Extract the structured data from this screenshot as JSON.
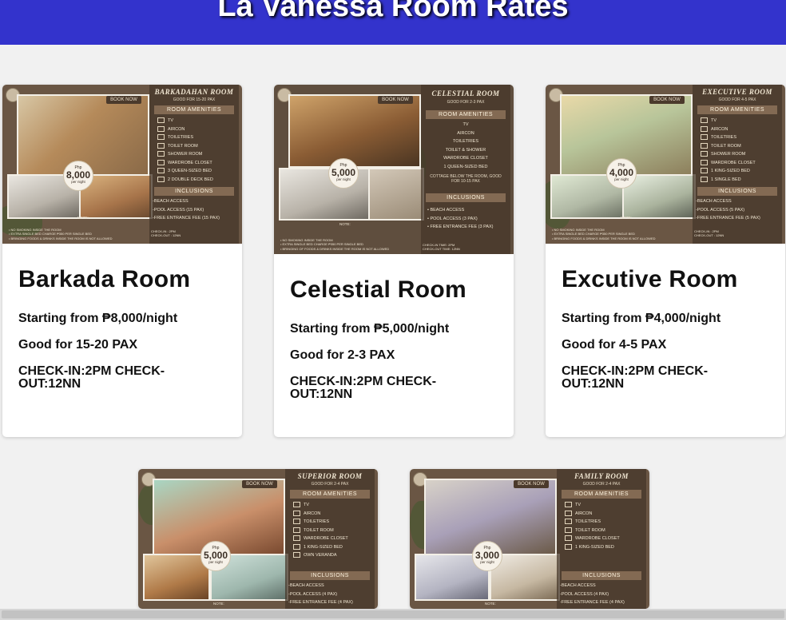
{
  "header": {
    "title": "La Vanessa Room Rates",
    "bg": "#3333cc"
  },
  "rooms": [
    {
      "name": "Barkada Room",
      "price_line": "Starting from ₱8,000/night",
      "pax_line": "Good for 15-20 PAX",
      "check_line": "CHECK-IN:2PM CHECK-OUT:12NN",
      "flyer": {
        "title": "BARKADAHAN ROOM",
        "subtitle": "GOOD FOR 15-20 PAX",
        "book": "BOOK NOW",
        "amenities_label": "ROOM AMENITIES",
        "amenities": [
          "TV",
          "AIRCON",
          "TOILETRIES",
          "TOILET ROOM",
          "SHOWER ROOM",
          "WARDROBE CLOSET",
          "3 QUEEN-SIZED BED",
          "2 DOUBLE DECK BED"
        ],
        "inclusions_label": "INCLUSIONS",
        "inclusions": [
          "-BEACH ACCESS",
          "-POOL ACCESS (15 PAX)",
          "-FREE ENTRANCE FEE (15 PAX)"
        ],
        "price_currency": "Php",
        "price_amount": "8,000",
        "price_per": "per night",
        "note_label": "NOTE:",
        "notes": [
          "• NO SMOKING INSIDE THE ROOM",
          "• EXTRA SINGLE BED CHARGE ₱350 PER SINGLE BED",
          "• BRINGING FOODS & DRINKS INSIDE THE ROOM IS NOT ALLOWED"
        ],
        "check": [
          "CHECK-IN : 2PM",
          "CHECK-OUT : 12NN"
        ]
      }
    },
    {
      "name": "Celestial Room",
      "price_line": "Starting from ₱5,000/night",
      "pax_line": "Good for 2-3 PAX",
      "check_line": "CHECK-IN:2PM CHECK-OUT:12NN",
      "flyer": {
        "title": "CELESTIAL ROOM",
        "subtitle": "GOOD FOR 2-3 PAX",
        "book": "BOOK NOW",
        "amenities_label": "ROOM AMENITIES",
        "amenities": [
          "TV",
          "AIRCON",
          "TOILETRIES",
          "TOILET & SHOWER",
          "WARDROBE CLOSET",
          "1 QUEEN-SIZED BED"
        ],
        "extra": "COTTAGE BELOW THE ROOM, GOOD FOR 10-15 PAX",
        "inclusions_label": "INCLUSIONS",
        "inclusions": [
          "• BEACH ACCESS",
          "• POOL ACCESS (3 PAX)",
          "• FREE ENTRANCE FEE (3 PAX)"
        ],
        "price_currency": "Php",
        "price_amount": "5,000",
        "price_per": "per night",
        "note_label": "NOTE:",
        "notes": [
          "• NO SMOKING INSIDE THE ROOM",
          "• EXTRA SINGLE BED CHARGE ₱350 PER SINGLE BED",
          "• BRINGING OF FOODS & DRINKS INSIDE THE ROOM IS NOT ALLOWED"
        ],
        "check": [
          "CHECK-IN TIME: 2PM",
          "CHECK-OUT TIME: 12NN"
        ]
      }
    },
    {
      "name": "Excutive Room",
      "price_line": "Starting from ₱4,000/night",
      "pax_line": "Good for 4-5 PAX",
      "check_line": "CHECK-IN:2PM CHECK-OUT:12NN",
      "flyer": {
        "title": "EXECUTIVE ROOM",
        "subtitle": "GOOD FOR 4-5 PAX",
        "book": "BOOK NOW",
        "amenities_label": "ROOM AMENITIES",
        "amenities": [
          "TV",
          "AIRCON",
          "TOILETRIES",
          "TOILET ROOM",
          "SHOWER ROOM",
          "WARDROBE CLOSET",
          "1 KING-SIZED BED",
          "1 SINGLE BED"
        ],
        "inclusions_label": "INCLUSIONS",
        "inclusions": [
          "-BEACH ACCESS",
          "-POOL ACCESS (5 PAX)",
          "-FREE ENTRANCE FEE (5 PAX)"
        ],
        "price_currency": "Php",
        "price_amount": "4,000",
        "price_per": "per night",
        "note_label": "NOTE:",
        "notes": [
          "• NO SMOKING INSIDE THE ROOM",
          "• EXTRA SINGLE BED CHARGE ₱350 PER SINGLE BED",
          "• BRINGING FOODS & DRINKS INSIDE THE ROOM IS NOT ALLOWED"
        ],
        "check": [
          "CHECK-IN : 2PM",
          "CHECK-OUT : 12NN"
        ]
      }
    },
    {
      "flyer": {
        "title": "SUPERIOR ROOM",
        "subtitle": "GOOD FOR 2-4 PAX",
        "book": "BOOK NOW",
        "amenities_label": "ROOM AMENITIES",
        "amenities": [
          "TV",
          "AIRCON",
          "TOILETRIES",
          "TOILET ROOM",
          "WARDROBE CLOSET",
          "1 KING-SIZED BED",
          "OWN VERANDA"
        ],
        "inclusions_label": "INCLUSIONS",
        "inclusions": [
          "-BEACH ACCESS",
          "-POOL ACCESS (4 PAX)",
          "-FREE ENTRANCE FEE (4 PAX)"
        ],
        "price_currency": "Php",
        "price_amount": "5,000",
        "price_per": "per night",
        "note_label": "NOTE:"
      }
    },
    {
      "flyer": {
        "title": "FAMILY ROOM",
        "subtitle": "GOOD FOR 2-4 PAX",
        "book": "BOOK NOW",
        "amenities_label": "ROOM AMENITIES",
        "amenities": [
          "TV",
          "AIRCON",
          "TOILETRIES",
          "TOILET ROOM",
          "WARDROBE CLOSET",
          "1 KING-SIZED BED"
        ],
        "inclusions_label": "INCLUSIONS",
        "inclusions": [
          "-BEACH ACCESS",
          "-POOL ACCESS (4 PAX)",
          "-FREE ENTRANCE FEE (4 PAX)"
        ],
        "price_currency": "Php",
        "price_amount": "3,000",
        "price_per": "per night",
        "note_label": "NOTE:"
      }
    }
  ]
}
